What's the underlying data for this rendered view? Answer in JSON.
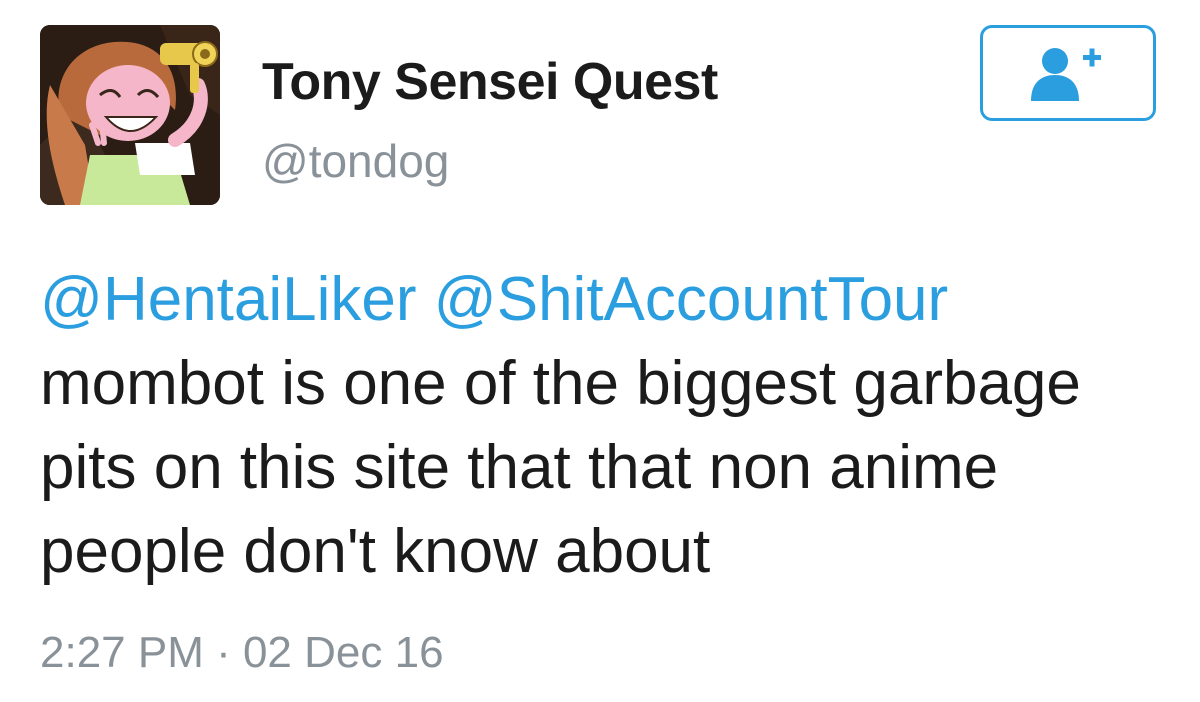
{
  "profile": {
    "display_name": "Tony Sensei Quest",
    "handle": "@tondog",
    "avatar_icon": "anime-character-hairdryer-avatar"
  },
  "follow_button": {
    "icon": "follow-user-plus-icon",
    "accent_color": "#2b9ee0"
  },
  "tweet": {
    "mentions": [
      "@HentaiLiker",
      "@ShitAccountTour"
    ],
    "lines": [
      "mombot is one of the biggest garbage",
      "pits on this site that that non anime",
      "people don't know about"
    ],
    "timestamp": "2:27 PM · 02 Dec 16"
  },
  "colors": {
    "link": "#2b9ee0",
    "text": "#1b1b1b",
    "muted": "#8a9299"
  }
}
